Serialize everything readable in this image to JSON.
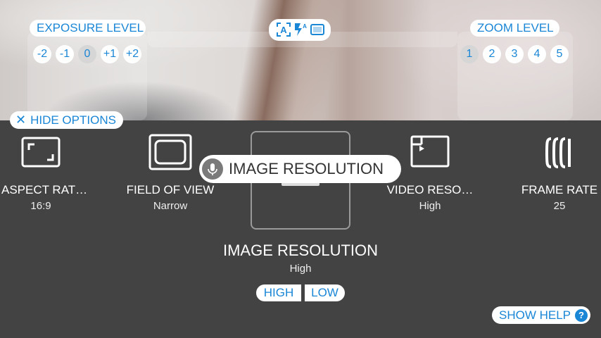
{
  "exposure": {
    "label": "EXPOSURE LEVEL",
    "values": [
      "-2",
      "-1",
      "0",
      "+1",
      "+2"
    ],
    "selected": "0"
  },
  "zoom": {
    "label": "ZOOM LEVEL",
    "values": [
      "1",
      "2",
      "3",
      "4",
      "5"
    ],
    "selected": "1"
  },
  "mode_icons": [
    "auto-mode-icon",
    "flash-auto-icon",
    "frame-icon"
  ],
  "hide_options": {
    "icon": "close-icon",
    "label": "HIDE OPTIONS"
  },
  "settings": [
    {
      "label": "ASPECT RAT…",
      "value": "16:9",
      "icon": "aspect-ratio-icon"
    },
    {
      "label": "FIELD OF VIEW",
      "value": "Narrow",
      "icon": "field-of-view-icon"
    },
    {
      "label": "IMAGE RESOLUTION",
      "value": "High",
      "icon": "image-resolution-icon"
    },
    {
      "label": "VIDEO RESO…",
      "value": "High",
      "icon": "video-resolution-icon"
    },
    {
      "label": "FRAME RATE",
      "value": "25",
      "icon": "frame-rate-icon"
    }
  ],
  "tooltip": {
    "icon": "microphone-icon",
    "text": "IMAGE RESOLUTION"
  },
  "detail": {
    "title": "IMAGE RESOLUTION",
    "value": "High",
    "options": [
      "HIGH",
      "LOW"
    ]
  },
  "show_help": {
    "label": "SHOW HELP",
    "icon_glyph": "?"
  },
  "colors": {
    "accent": "#1a86d6",
    "background": "#434343"
  }
}
